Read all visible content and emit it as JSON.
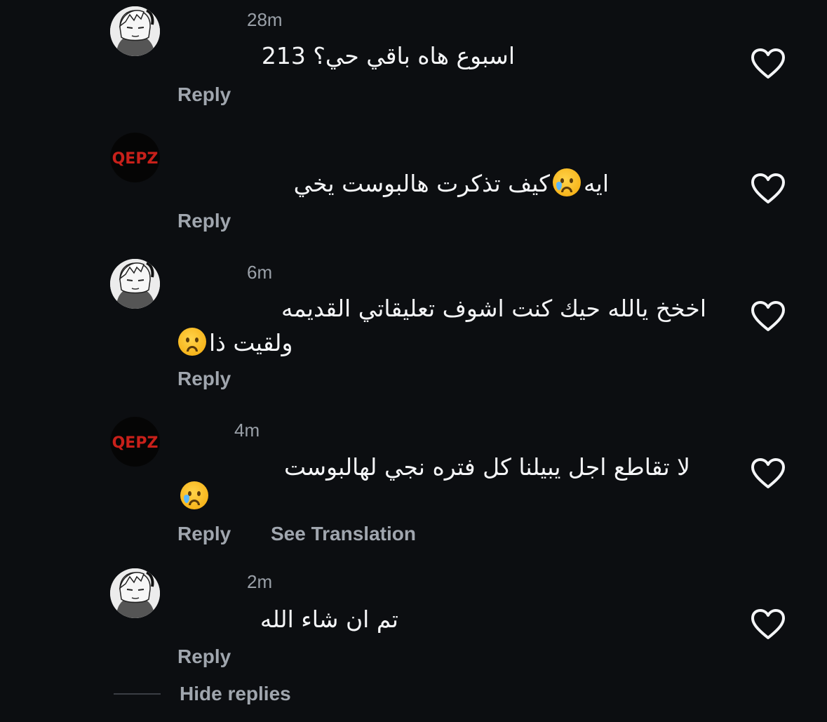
{
  "comments": [
    {
      "avatar": "manga-character-avatar",
      "time": "28m",
      "text": "اسبوع هاه باقي حي؟ 213",
      "emoji": null,
      "reply_label": "Reply"
    },
    {
      "avatar": "qepz-logo-avatar",
      "avatar_text": "QEPZ",
      "time": "",
      "text_before_emoji": "ايه",
      "emoji": "crying-face",
      "text_after_emoji": "كيف تذكرت هالبوست يخي",
      "reply_label": "Reply"
    },
    {
      "avatar": "manga-character-avatar",
      "time": "6m",
      "text_line1": "اخخخ يالله حيك كنت اشوف تعليقاتي القديمه",
      "text_line2": "ولقيت ذا",
      "emoji": "frowning-face",
      "reply_label": "Reply"
    },
    {
      "avatar": "qepz-logo-avatar",
      "avatar_text": "QEPZ",
      "time": "4m",
      "text": "لا تقاطع اجل يبيلنا كل فتره نجي لهالبوست",
      "emoji": "crying-face",
      "reply_label": "Reply",
      "see_translation_label": "See Translation"
    },
    {
      "avatar": "manga-character-avatar",
      "time": "2m",
      "text": "تم ان شاء الله",
      "emoji": null,
      "reply_label": "Reply"
    }
  ],
  "footer": {
    "hide_replies_label": "Hide replies"
  },
  "icons": {
    "like": "heart-outline-icon"
  },
  "colors": {
    "background": "#0c0e11",
    "primary_text": "#f4f5f7",
    "secondary_text": "#a0a6ae",
    "qepz_red": "#c8201a"
  }
}
